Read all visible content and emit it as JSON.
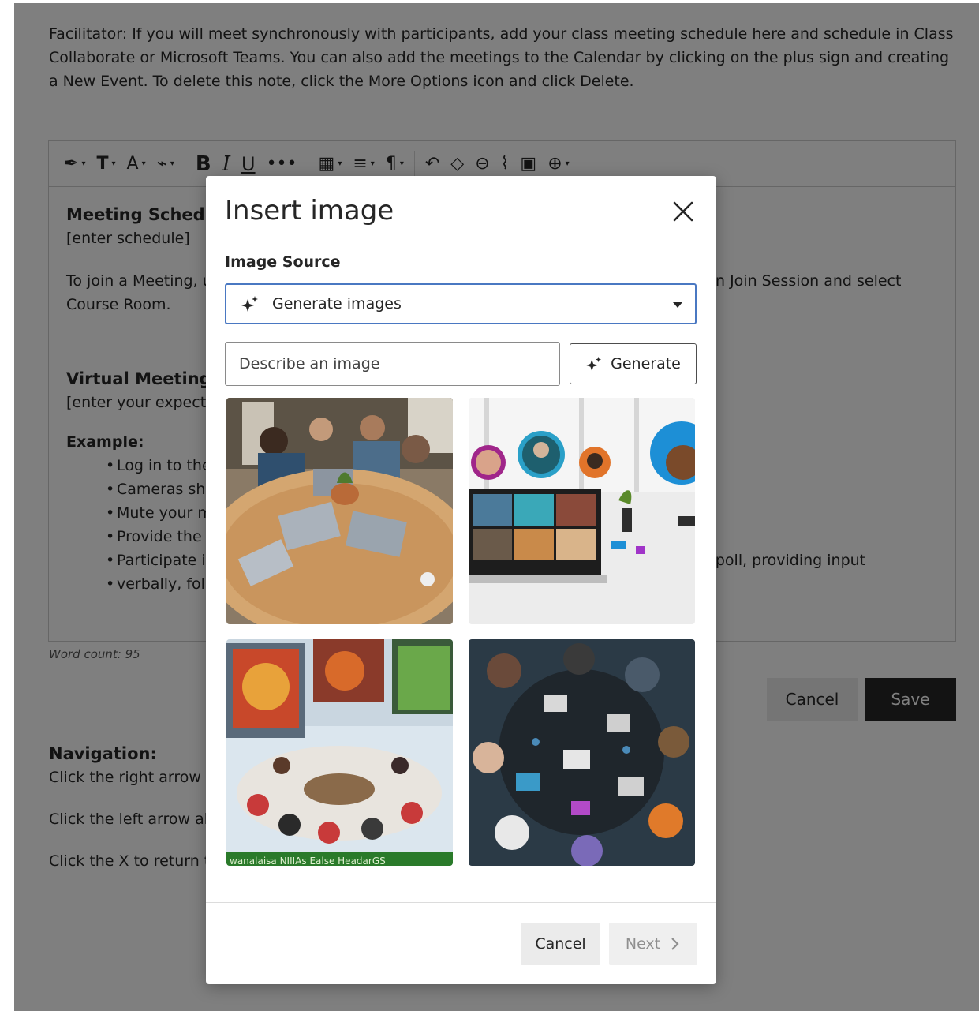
{
  "note": {
    "text": "Facilitator: If you will meet synchronously with participants, add your class meeting schedule here and schedule in Class Collaborate or Microsoft Teams. You can also add the meetings to the Calendar by clicking on the plus sign and creating a New Event. To delete this note, click the More Options icon and click Delete."
  },
  "toolbar": {
    "items": [
      "text-style",
      "font-type",
      "font-size",
      "highlight",
      "bold",
      "italic",
      "underline",
      "more",
      "table",
      "align",
      "paragraph",
      "undo",
      "clear-format",
      "link",
      "attach",
      "image",
      "insert-more"
    ]
  },
  "editor": {
    "meeting_heading": "Meeting Schedu",
    "meeting_placeholder": "[enter schedule]",
    "join_text_left": "To join a Meeting, u",
    "join_text_right": "n Join Session and select",
    "join_text_line2": "Course Room.",
    "virtual_heading": "Virtual Meeting",
    "virtual_placeholder": "[enter your expecta",
    "example_heading": "Example:",
    "bullets": [
      "Log in to the",
      "Cameras sho",
      "Mute your m",
      "Provide the",
      "Participate i"
    ],
    "last_bullet_right": "r poll, providing input",
    "last_bullet_line2": "verbally, foll"
  },
  "word_count": "Word count: 95",
  "bg_buttons": {
    "cancel": "Cancel",
    "save": "Save"
  },
  "navigation": {
    "heading": "Navigation:",
    "lines": [
      "Click the right arrow a",
      "Click the left arrow ab",
      "Click the X to return t"
    ]
  },
  "modal": {
    "title": "Insert image",
    "source_label": "Image Source",
    "source_value": "Generate images",
    "describe_placeholder": "Describe an image",
    "generate_label": "Generate",
    "cancel_label": "Cancel",
    "next_label": "Next",
    "image3_caption": "wanalaisa NIIIAs Ealse HeadarGS",
    "icons": {
      "close": "close-icon",
      "sparkle": "sparkle-icon",
      "dropdown": "caret-down-icon",
      "next": "chevron-right-icon"
    }
  },
  "colors": {
    "overlay": "rgba(0,0,0,0.5)",
    "focus_border": "#4a78c2",
    "save_bg": "#262626"
  }
}
